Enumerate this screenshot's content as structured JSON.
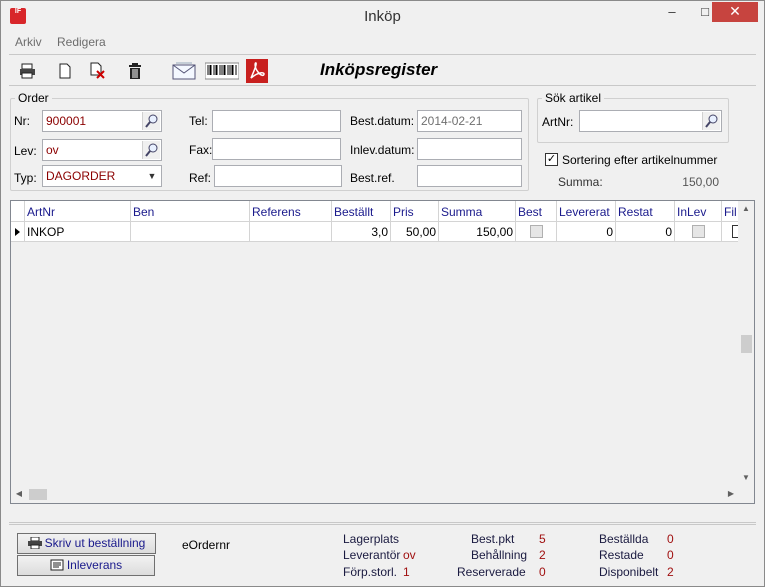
{
  "window": {
    "title": "Inköp",
    "icon_text": "IF",
    "minimize": "–",
    "maximize": "□",
    "close": "✕"
  },
  "menu": [
    "Arkiv",
    "Redigera"
  ],
  "toolbar": {
    "title": "Inköpsregister",
    "buttons": [
      "print-icon",
      "new-document-icon",
      "delete-document-icon",
      "trash-icon",
      "email-icon",
      "barcode-icon",
      "pdf-icon"
    ]
  },
  "order": {
    "legend": "Order",
    "nr_label": "Nr:",
    "nr_value": "900001",
    "lev_label": "Lev:",
    "lev_value": "ov",
    "typ_label": "Typ:",
    "typ_value": "DAGORDER",
    "tel_label": "Tel:",
    "tel_value": "",
    "fax_label": "Fax:",
    "fax_value": "",
    "ref_label": "Ref:",
    "ref_value": "",
    "bestdatum_label": "Best.datum:",
    "bestdatum_value": "2014-02-21",
    "inlevdatum_label": "Inlev.datum:",
    "inlevdatum_value": "",
    "bestref_label": "Best.ref.",
    "bestref_value": ""
  },
  "search": {
    "legend": "Sök artikel",
    "artnr_label": "ArtNr:",
    "artnr_value": "",
    "sort_label": "Sortering efter artikelnummer",
    "sort_checked": true,
    "summa_label": "Summa:",
    "summa_value": "150,00"
  },
  "grid": {
    "columns": [
      "ArtNr",
      "Ben",
      "Referens",
      "Beställt",
      "Pris",
      "Summa",
      "Best",
      "Levererat",
      "Restat",
      "InLev",
      "Fil"
    ],
    "rows": [
      {
        "artnr": "INKOP",
        "ben": "",
        "referens": "",
        "bestallt": "3,0",
        "pris": "50,00",
        "summa": "150,00",
        "best": false,
        "levererat": "0",
        "restat": "0",
        "inlev": false
      }
    ]
  },
  "bottom": {
    "print_button": "Skriv ut beställning",
    "delivery_button": "Inleverans",
    "eordernr_label": "eOrdernr",
    "lagerplats_label": "Lagerplats",
    "lagerplats_value": "",
    "leverantor_label": "Leverantör",
    "leverantor_value": "ov",
    "forpstorl_label": "Förp.storl.",
    "forpstorl_value": "1",
    "bestpkt_label": "Best.pkt",
    "bestpkt_value": "5",
    "behallning_label": "Behållning",
    "behallning_value": "2",
    "reserverade_label": "Reserverade",
    "reserverade_value": "0",
    "bestallda_label": "Beställda",
    "bestallda_value": "0",
    "restade_label": "Restade",
    "restade_value": "0",
    "disponibelt_label": "Disponibelt",
    "disponibelt_value": "2"
  }
}
